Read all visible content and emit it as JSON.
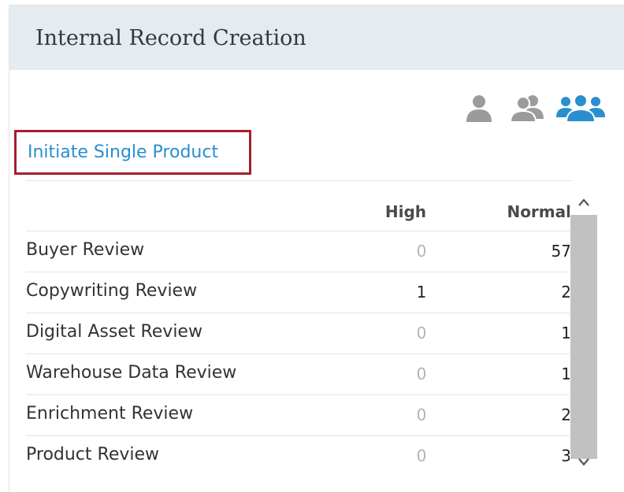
{
  "panel": {
    "title": "Internal Record Creation"
  },
  "view_icons": [
    {
      "name": "single-user-icon",
      "color": "#9b9b9b",
      "active": false
    },
    {
      "name": "two-users-icon",
      "color": "#9b9b9b",
      "active": false
    },
    {
      "name": "three-users-icon",
      "color": "#2a8ed0",
      "active": true
    }
  ],
  "initiate": {
    "label": "Initiate Single Product"
  },
  "table": {
    "columns": [
      "",
      "High",
      "Normal"
    ],
    "rows": [
      {
        "label": "Buyer Review",
        "high": "0",
        "normal": "57"
      },
      {
        "label": "Copywriting Review",
        "high": "1",
        "normal": "2"
      },
      {
        "label": "Digital Asset Review",
        "high": "0",
        "normal": "1"
      },
      {
        "label": "Warehouse Data Review",
        "high": "0",
        "normal": "1"
      },
      {
        "label": "Enrichment Review",
        "high": "0",
        "normal": "2"
      },
      {
        "label": "Product Review",
        "high": "0",
        "normal": "3"
      }
    ]
  },
  "scrollbar": {
    "up_icon": "chevron-up-icon",
    "down_icon": "chevron-down-icon"
  }
}
